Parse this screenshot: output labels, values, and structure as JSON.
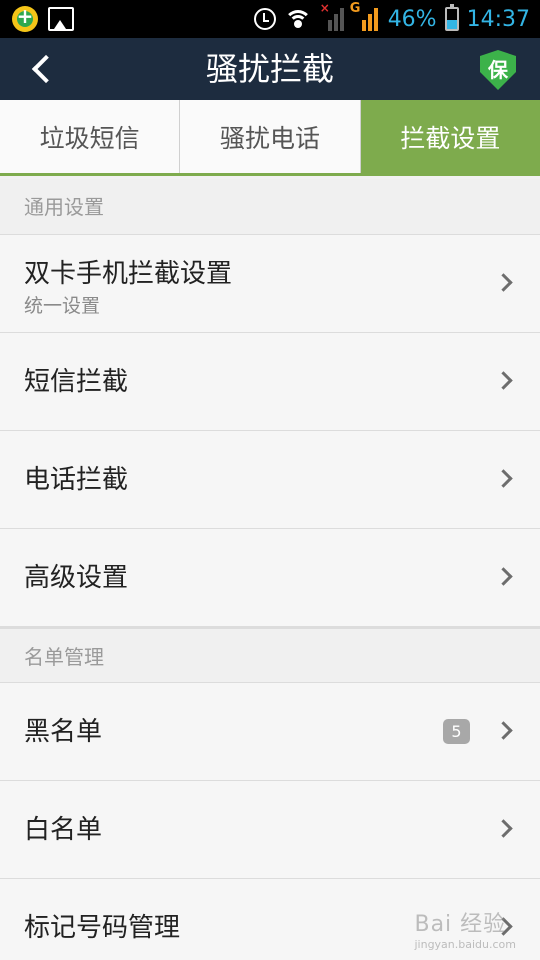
{
  "status_bar": {
    "icons": [
      "app-icon",
      "image-icon",
      "alarm-icon",
      "wifi-icon",
      "signal-icon",
      "signal-g-icon",
      "battery-icon"
    ],
    "network_label": "G",
    "battery_percent": "46%",
    "time": "14:37",
    "accent_color": "#33b5e5"
  },
  "app_bar": {
    "title": "骚扰拦截",
    "shield_label": "保",
    "background": "#1d2c3f"
  },
  "tabs": [
    {
      "label": "垃圾短信",
      "active": false
    },
    {
      "label": "骚扰电话",
      "active": false
    },
    {
      "label": "拦截设置",
      "active": true
    }
  ],
  "tab_active_color": "#7eab4d",
  "sections": [
    {
      "header": "通用设置",
      "items": [
        {
          "label": "双卡手机拦截设置",
          "sub": "统一设置"
        },
        {
          "label": "短信拦截"
        },
        {
          "label": "电话拦截"
        },
        {
          "label": "高级设置"
        }
      ]
    },
    {
      "header": "名单管理",
      "items": [
        {
          "label": "黑名单",
          "badge": "5"
        },
        {
          "label": "白名单"
        },
        {
          "label": "标记号码管理"
        }
      ]
    }
  ],
  "watermark": "Bai 经验",
  "watermark_sub": "jingyan.baidu.com"
}
